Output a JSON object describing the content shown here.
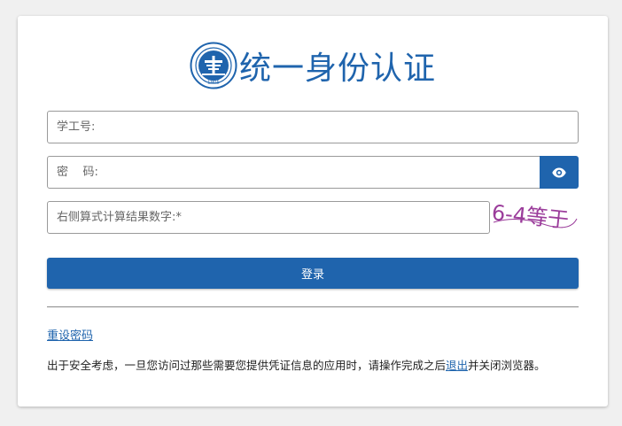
{
  "header": {
    "logo_year": "1905",
    "title": "统一身份认证"
  },
  "form": {
    "username_placeholder": "学工号:",
    "password_placeholder": "密    码:",
    "captcha_placeholder": "右侧算式计算结果数字:*",
    "captcha_text": "6-4等于",
    "login_label": "登录",
    "toggle_icon": "eye-icon"
  },
  "links": {
    "reset_password": "重设密码"
  },
  "notice": {
    "before": "出于安全考虑，一旦您访问过那些需要您提供凭证信息的应用时，请操作完成之后",
    "link": "退出",
    "after": "并关闭浏览器。"
  },
  "colors": {
    "brand": "#1f64ad",
    "captcha": "#9b3d9b"
  }
}
